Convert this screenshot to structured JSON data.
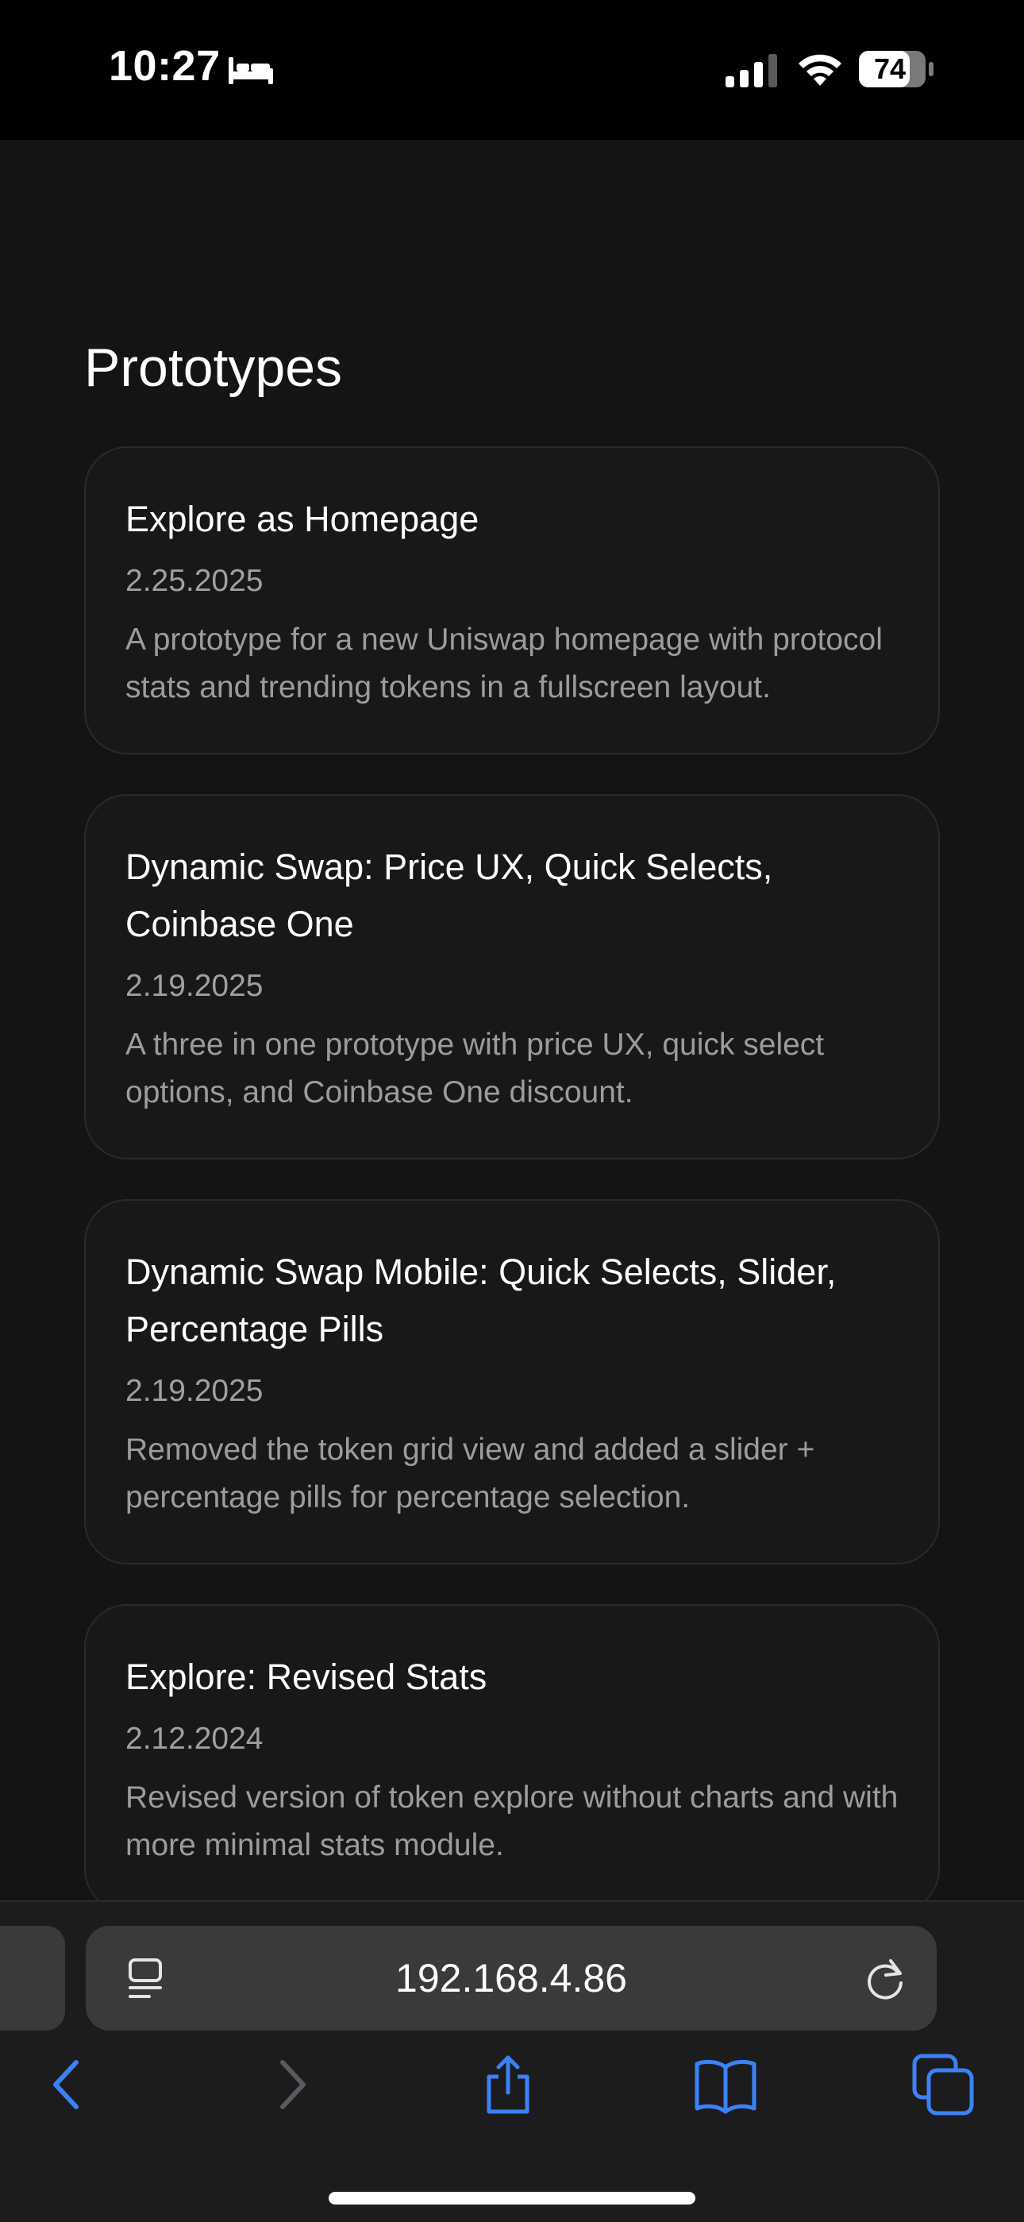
{
  "status_bar": {
    "time": "10:27",
    "battery_level": "74",
    "icons": [
      "bed-icon",
      "signal-icon",
      "wifi-icon",
      "battery-icon"
    ]
  },
  "page": {
    "title": "Prototypes"
  },
  "cards": [
    {
      "title": "Explore as Homepage",
      "date": "2.25.2025",
      "description": "A prototype for a new Uniswap homepage with protocol stats and trending tokens in a fullscreen layout."
    },
    {
      "title": "Dynamic Swap: Price UX, Quick Selects, Coinbase One",
      "date": "2.19.2025",
      "description": "A three in one prototype with price UX, quick select options, and Coinbase One discount."
    },
    {
      "title": "Dynamic Swap Mobile: Quick Selects, Slider, Percentage Pills",
      "date": "2.19.2025",
      "description": "Removed the token grid view and added a slider + percentage pills for percentage selection."
    },
    {
      "title": "Explore: Revised Stats",
      "date": "2.12.2024",
      "description": "Revised version of token explore without charts and with more minimal stats module."
    }
  ],
  "browser": {
    "url": "192.168.4.86",
    "toolbar_icons": [
      "back-icon",
      "forward-icon",
      "share-icon",
      "bookmarks-icon",
      "tabs-icon",
      "reader-icon",
      "reload-icon"
    ],
    "accent_color": "#3b82f6"
  }
}
